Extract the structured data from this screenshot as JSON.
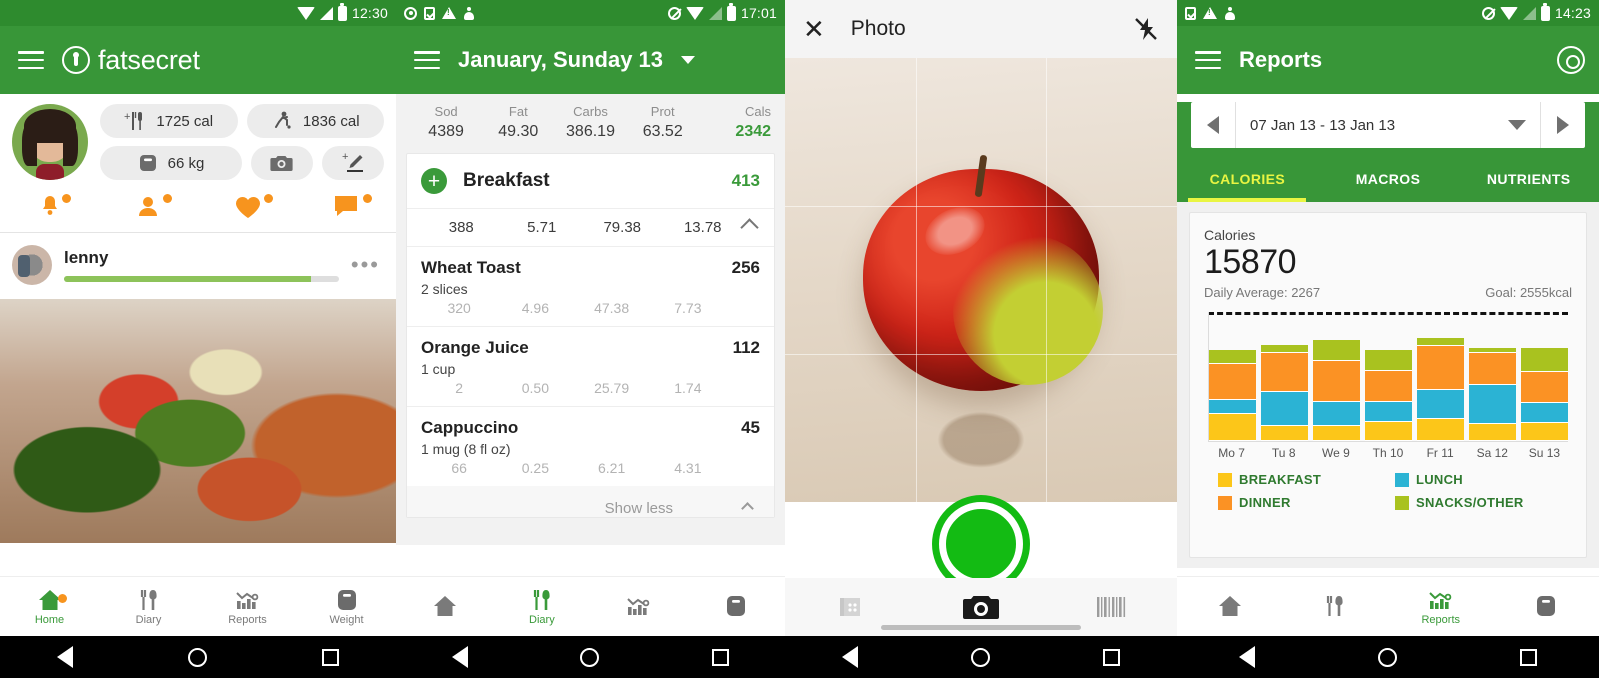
{
  "theme": {
    "green": "#389638",
    "green_dark": "#2e8b2e",
    "accent_orange": "#f7941e",
    "yellow": "#e9f542",
    "text_dark": "#222222"
  },
  "panel_home": {
    "statusbar": {
      "time": "12:30",
      "icons": [
        "wifi-icon",
        "signal-icon",
        "battery-icon"
      ]
    },
    "appbar": {
      "brand": "fatsecret",
      "menu_icon": "hamburger-icon",
      "logo_icon": "fatsecret-logo-icon"
    },
    "chips": [
      {
        "icon": "add-food-icon",
        "label": "1725 cal"
      },
      {
        "icon": "exercise-icon",
        "label": "1836 cal"
      },
      {
        "icon": "scale-icon",
        "label": "66 kg"
      },
      {
        "icon": "camera-icon",
        "label": ""
      },
      {
        "icon": "add-note-icon",
        "label": ""
      }
    ],
    "social_icons": [
      "bell-icon",
      "friends-icon",
      "heart-icon",
      "comment-icon"
    ],
    "feed": {
      "username": "lenny",
      "progress_percent": 90,
      "more_icon": "more-dots-icon",
      "photo": "food-photo"
    },
    "bottom_nav": [
      {
        "icon": "home-icon",
        "label": "Home",
        "active": true,
        "badge": true
      },
      {
        "icon": "diary-icon",
        "label": "Diary",
        "active": false,
        "badge": false
      },
      {
        "icon": "reports-icon",
        "label": "Reports",
        "active": false,
        "badge": false
      },
      {
        "icon": "weight-icon",
        "label": "Weight",
        "active": false,
        "badge": false
      }
    ]
  },
  "panel_diary": {
    "statusbar": {
      "time": "17:01",
      "left_icons": [
        "eye-icon",
        "download-icon",
        "warning-icon",
        "android-icon"
      ],
      "right_icons": [
        "no-entry-icon",
        "wifi-icon",
        "signal-icon",
        "battery-charging-icon"
      ]
    },
    "appbar": {
      "title": "January, Sunday 13",
      "menu_icon": "hamburger-icon",
      "caret_icon": "chevron-down-icon"
    },
    "macro_header": {
      "columns": [
        "Sod",
        "Fat",
        "Carbs",
        "Prot",
        "Cals"
      ],
      "values": [
        "4389",
        "49.30",
        "386.19",
        "63.52",
        "2342"
      ]
    },
    "meal": {
      "name": "Breakfast",
      "calories": "413",
      "add_icon": "add-circle-icon",
      "collapse_icon": "chevron-up-icon",
      "totals": [
        "388",
        "5.71",
        "79.38",
        "13.78"
      ]
    },
    "foods": [
      {
        "name": "Wheat Toast",
        "calories": "256",
        "serving": "2 slices",
        "nums": [
          "320",
          "4.96",
          "47.38",
          "7.73"
        ]
      },
      {
        "name": "Orange Juice",
        "calories": "112",
        "serving": "1 cup",
        "nums": [
          "2",
          "0.50",
          "25.79",
          "1.74"
        ]
      },
      {
        "name": "Cappuccino",
        "calories": "45",
        "serving": "1 mug (8 fl oz)",
        "nums": [
          "66",
          "0.25",
          "6.21",
          "4.31"
        ]
      }
    ],
    "show_less": "Show less",
    "bottom_nav": [
      {
        "icon": "home-icon",
        "label": "",
        "active": false
      },
      {
        "icon": "diary-icon",
        "label": "Diary",
        "active": true
      },
      {
        "icon": "reports-icon",
        "label": "",
        "active": false
      },
      {
        "icon": "weight-icon",
        "label": "",
        "active": false
      }
    ]
  },
  "panel_camera": {
    "topbar": {
      "close_icon": "close-icon",
      "title": "Photo",
      "flash_icon": "flash-off-icon"
    },
    "viewfinder": {
      "subject": "apple-photo",
      "grid": true
    },
    "shutter": {
      "icon": "shutter-button-icon"
    },
    "bottom": [
      {
        "icon": "gallery-icon"
      },
      {
        "icon": "camera-icon"
      },
      {
        "icon": "barcode-icon"
      }
    ]
  },
  "panel_reports": {
    "statusbar": {
      "time": "14:23",
      "left_icons": [
        "download-icon",
        "warning-icon",
        "android-icon"
      ],
      "right_icons": [
        "no-entry-icon",
        "wifi-icon",
        "signal-icon",
        "battery-charging-icon"
      ]
    },
    "appbar": {
      "title": "Reports",
      "menu_icon": "hamburger-icon",
      "goal_icon": "target-icon"
    },
    "date_range": {
      "text": "07 Jan 13 - 13 Jan 13",
      "prev_icon": "arrow-left-icon",
      "next_icon": "arrow-right-icon",
      "dropdown_icon": "chevron-down-icon"
    },
    "tabs": [
      {
        "label": "CALORIES",
        "active": true
      },
      {
        "label": "MACROS",
        "active": false
      },
      {
        "label": "NUTRIENTS",
        "active": false
      }
    ],
    "summary": {
      "label": "Calories",
      "total": "15870",
      "daily_average": "Daily Average: 2267",
      "goal": "Goal: 2555kcal"
    },
    "bottom_nav": [
      {
        "icon": "home-icon",
        "label": "",
        "active": false
      },
      {
        "icon": "diary-icon",
        "label": "",
        "active": false
      },
      {
        "icon": "reports-icon",
        "label": "Reports",
        "active": true
      },
      {
        "icon": "weight-icon",
        "label": "",
        "active": false
      }
    ]
  },
  "chart_data": {
    "type": "bar",
    "stacked": true,
    "title": "Calories",
    "xlabel": "",
    "ylabel": "Calories",
    "ylim": [
      0,
      2900
    ],
    "grid": false,
    "legend_position": "bottom",
    "goal_line": 2555,
    "goal_line_label": "Goal: 2555kcal",
    "categories": [
      "Mo 7",
      "Tu 8",
      "We 9",
      "Th 10",
      "Fr 11",
      "Sa 12",
      "Su 13"
    ],
    "series": [
      {
        "name": "BREAKFAST",
        "color": "#fcc619",
        "values": [
          600,
          330,
          330,
          420,
          500,
          380,
          400
        ]
      },
      {
        "name": "LUNCH",
        "color": "#2bb3d4",
        "values": [
          320,
          780,
          560,
          470,
          640,
          880,
          450
        ]
      },
      {
        "name": "DINNER",
        "color": "#fb9224",
        "values": [
          820,
          860,
          900,
          680,
          1000,
          720,
          710
        ]
      },
      {
        "name": "SNACKS/OTHER",
        "color": "#a9c21f",
        "values": [
          310,
          190,
          480,
          480,
          180,
          110,
          540
        ]
      }
    ],
    "totals": [
      2050,
      2160,
      2270,
      2050,
      2320,
      2090,
      2100
    ]
  },
  "system_nav": {
    "back_icon": "back-icon",
    "home_icon": "home-circle-icon",
    "recents_icon": "recents-icon"
  }
}
